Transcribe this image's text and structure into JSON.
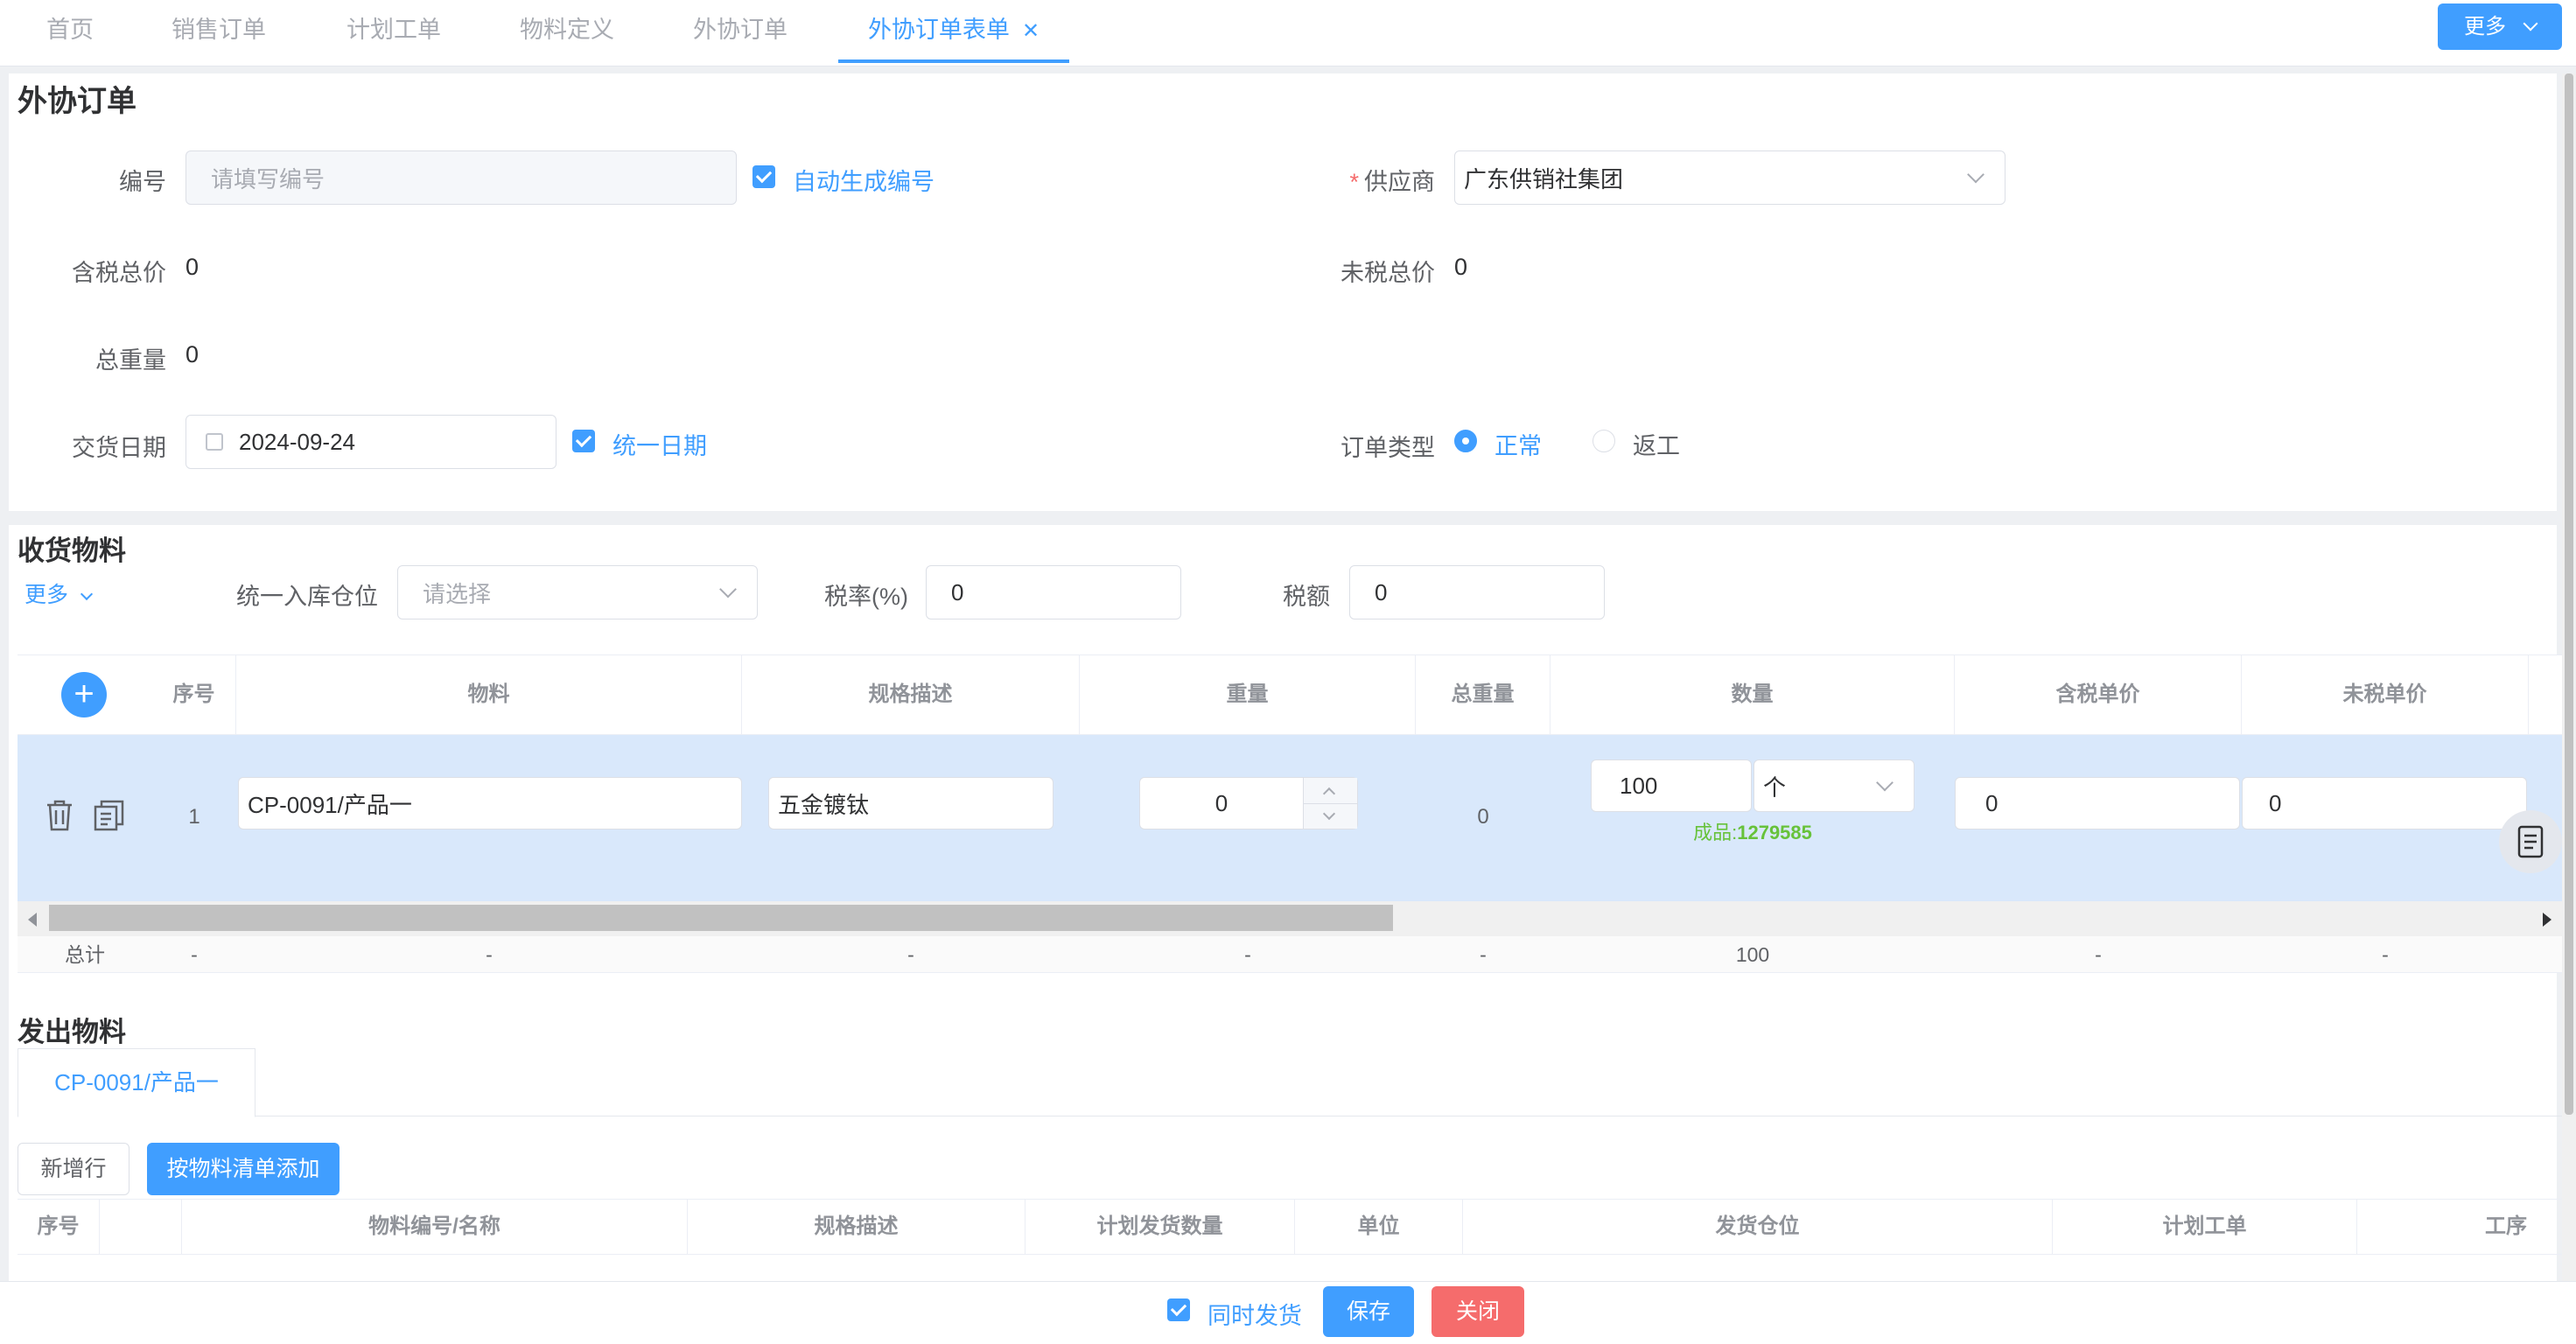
{
  "tabs": [
    {
      "label": "首页"
    },
    {
      "label": "销售订单"
    },
    {
      "label": "计划工单"
    },
    {
      "label": "物料定义"
    },
    {
      "label": "外协订单"
    },
    {
      "label": "外协订单表单",
      "active": true
    }
  ],
  "top_more": "更多",
  "order": {
    "title": "外协订单",
    "number_label": "编号",
    "number_placeholder": "请填写编号",
    "auto_number_label": "自动生成编号",
    "auto_number_checked": true,
    "supplier_required": "*",
    "supplier_label": "供应商",
    "supplier_value": "广东供销社集团",
    "tax_total_label": "含税总价",
    "tax_total_value": "0",
    "untaxed_total_label": "未税总价",
    "untaxed_total_value": "0",
    "weight_total_label": "总重量",
    "weight_total_value": "0",
    "delivery_date_label": "交货日期",
    "delivery_date_value": "2024-09-24",
    "unify_date_label": "统一日期",
    "unify_date_checked": true,
    "order_type_label": "订单类型",
    "order_type_options": [
      "正常",
      "返工"
    ],
    "order_type_selected": "正常"
  },
  "receive": {
    "title": "收货物料",
    "more_label": "更多",
    "warehouse_label": "统一入库仓位",
    "warehouse_placeholder": "请选择",
    "tax_rate_label": "税率(%)",
    "tax_rate_value": "0",
    "tax_amount_label": "税额",
    "tax_amount_value": "0",
    "columns": [
      "序号",
      "物料",
      "规格描述",
      "重量",
      "总重量",
      "数量",
      "含税单价",
      "未税单价"
    ],
    "rows": [
      {
        "index": "1",
        "material": "CP-0091/产品一",
        "spec": "五金镀钛",
        "weight": "0",
        "total_weight": "0",
        "quantity": "100",
        "unit": "个",
        "stock_label": "成品:",
        "stock_value": "1279585",
        "tax_price": "0",
        "untaxed_price": "0"
      }
    ],
    "footer": {
      "label": "总计",
      "index": "-",
      "material": "-",
      "spec": "-",
      "weight": "-",
      "total_weight": "-",
      "quantity": "100",
      "tax_price": "-",
      "untaxed_price": "-"
    }
  },
  "issue": {
    "title": "发出物料",
    "tab_label": "CP-0091/产品一",
    "add_row_label": "新增行",
    "add_bom_label": "按物料清单添加",
    "columns": [
      "序号",
      "物料编号/名称",
      "规格描述",
      "计划发货数量",
      "单位",
      "发货仓位",
      "计划工单",
      "工序"
    ]
  },
  "bottom": {
    "ship_label": "同时发货",
    "ship_checked": true,
    "save_label": "保存",
    "close_label": "关闭"
  },
  "colors": {
    "primary": "#409eff",
    "danger": "#f56c6c",
    "stock_green": "#67c23a",
    "row_highlight": "#d9e8fb"
  }
}
